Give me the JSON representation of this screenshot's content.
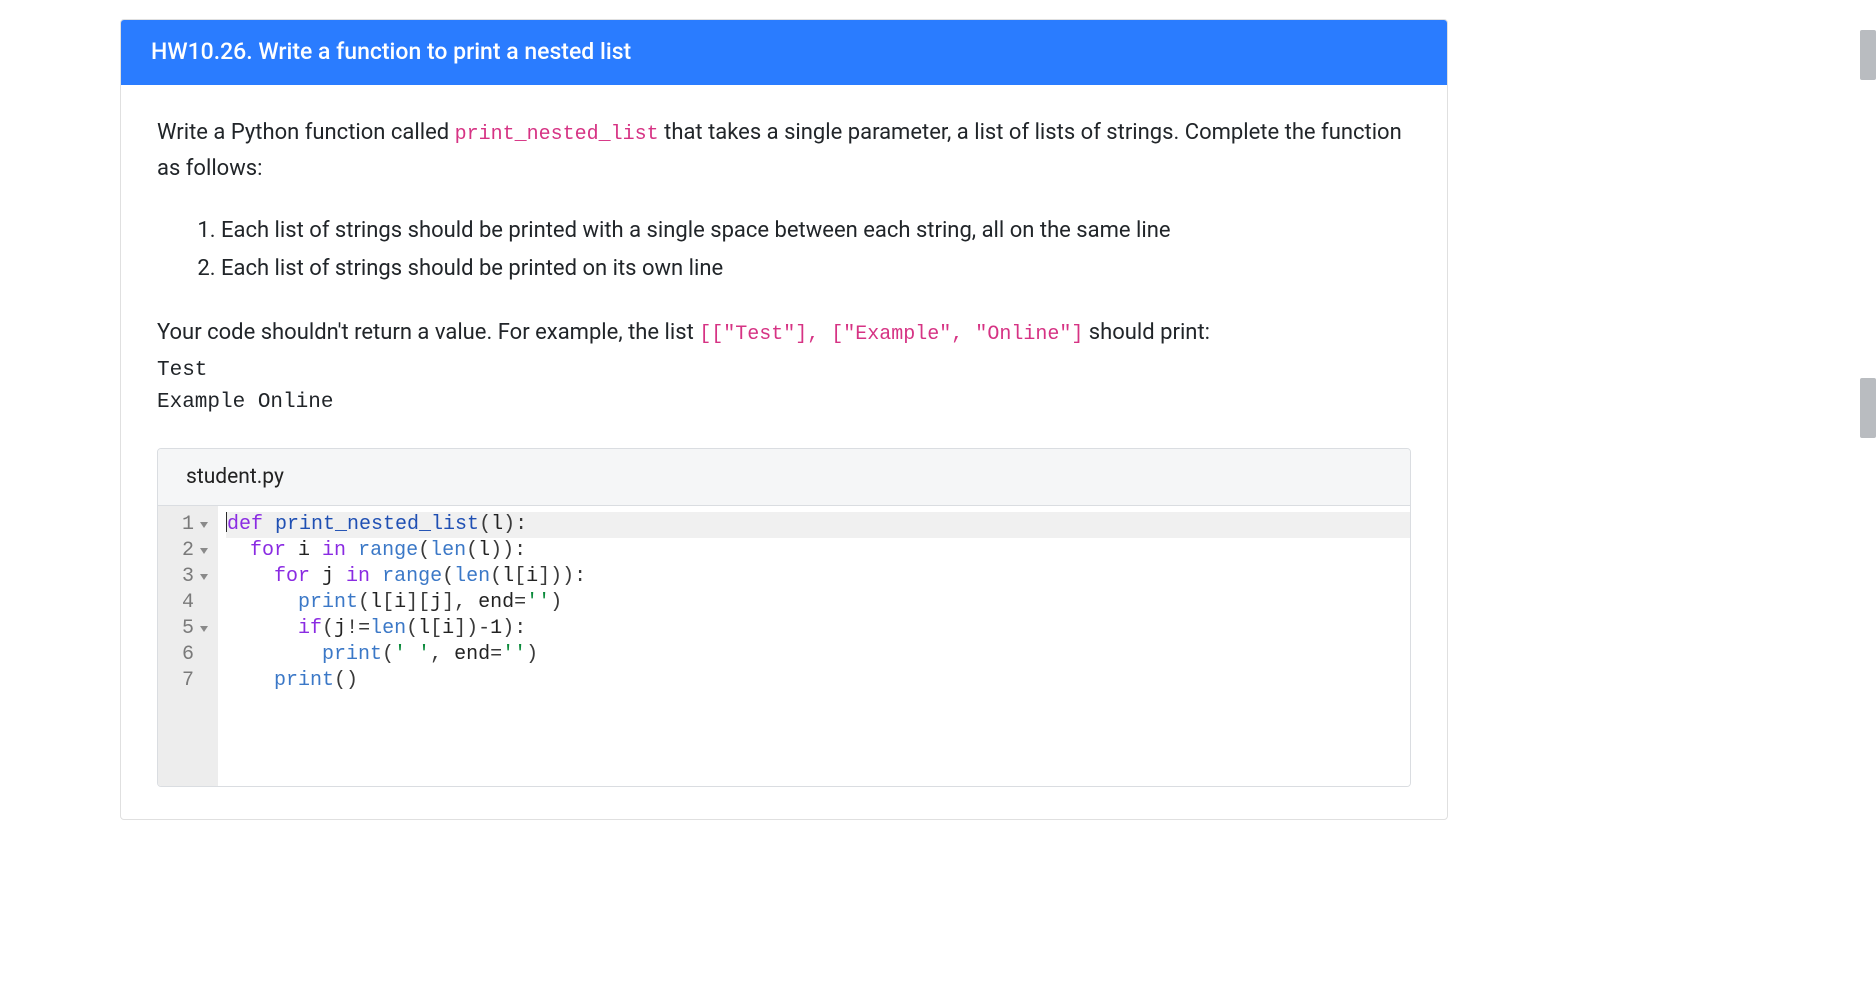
{
  "header": {
    "title": "HW10.26. Write a function to print a nested list"
  },
  "intro": {
    "lead_before": "Write a Python function called ",
    "fn_name": "print_nested_list",
    "lead_after": " that takes a single parameter, a list of lists of strings. Complete the function as follows:"
  },
  "requirements": [
    "Each list of strings should be printed with a single space between each string, all on the same line",
    "Each list of strings should be printed on its own line"
  ],
  "example": {
    "before": "Your code shouldn't return a value. For example, the list ",
    "code": "[[\"Test\"], [\"Example\", \"Online\"]",
    "after": " should print:",
    "output": "Test\nExample Online"
  },
  "editor": {
    "filename": "student.py",
    "gutter": [
      {
        "n": "1",
        "fold": true
      },
      {
        "n": "2",
        "fold": true
      },
      {
        "n": "3",
        "fold": true
      },
      {
        "n": "4",
        "fold": false
      },
      {
        "n": "5",
        "fold": true
      },
      {
        "n": "6",
        "fold": false
      },
      {
        "n": "7",
        "fold": false
      }
    ],
    "code_lines": [
      {
        "indent": 0,
        "tokens": [
          [
            "kw",
            "def "
          ],
          [
            "fn",
            "print_nested_list"
          ],
          [
            "punc",
            "("
          ],
          [
            "plain",
            "l"
          ],
          [
            "punc",
            "):"
          ]
        ],
        "highlight": true,
        "cursor": true
      },
      {
        "indent": 1,
        "tokens": [
          [
            "kw",
            "for "
          ],
          [
            "plain",
            "i "
          ],
          [
            "kw",
            "in "
          ],
          [
            "call",
            "range"
          ],
          [
            "punc",
            "("
          ],
          [
            "call",
            "len"
          ],
          [
            "punc",
            "("
          ],
          [
            "plain",
            "l"
          ],
          [
            "punc",
            ")):"
          ]
        ]
      },
      {
        "indent": 2,
        "tokens": [
          [
            "kw",
            "for "
          ],
          [
            "plain",
            "j "
          ],
          [
            "kw",
            "in "
          ],
          [
            "call",
            "range"
          ],
          [
            "punc",
            "("
          ],
          [
            "call",
            "len"
          ],
          [
            "punc",
            "("
          ],
          [
            "plain",
            "l"
          ],
          [
            "punc",
            "["
          ],
          [
            "plain",
            "i"
          ],
          [
            "punc",
            "])):"
          ]
        ]
      },
      {
        "indent": 3,
        "tokens": [
          [
            "call",
            "print"
          ],
          [
            "punc",
            "("
          ],
          [
            "plain",
            "l"
          ],
          [
            "punc",
            "["
          ],
          [
            "plain",
            "i"
          ],
          [
            "punc",
            "]["
          ],
          [
            "plain",
            "j"
          ],
          [
            "punc",
            "], "
          ],
          [
            "plain",
            "end"
          ],
          [
            "punc",
            "="
          ],
          [
            "str",
            "''"
          ],
          [
            "punc",
            ")"
          ]
        ]
      },
      {
        "indent": 3,
        "tokens": [
          [
            "kw",
            "if"
          ],
          [
            "punc",
            "("
          ],
          [
            "plain",
            "j"
          ],
          [
            "punc",
            "!="
          ],
          [
            "call",
            "len"
          ],
          [
            "punc",
            "("
          ],
          [
            "plain",
            "l"
          ],
          [
            "punc",
            "["
          ],
          [
            "plain",
            "i"
          ],
          [
            "punc",
            "])-"
          ],
          [
            "plain",
            "1"
          ],
          [
            "punc",
            "):"
          ]
        ]
      },
      {
        "indent": 4,
        "tokens": [
          [
            "call",
            "print"
          ],
          [
            "punc",
            "("
          ],
          [
            "str",
            "' '"
          ],
          [
            "punc",
            ", "
          ],
          [
            "plain",
            "end"
          ],
          [
            "punc",
            "="
          ],
          [
            "str",
            "''"
          ],
          [
            "punc",
            ")"
          ]
        ]
      },
      {
        "indent": 2,
        "tokens": [
          [
            "call",
            "print"
          ],
          [
            "punc",
            "()"
          ]
        ]
      }
    ]
  }
}
